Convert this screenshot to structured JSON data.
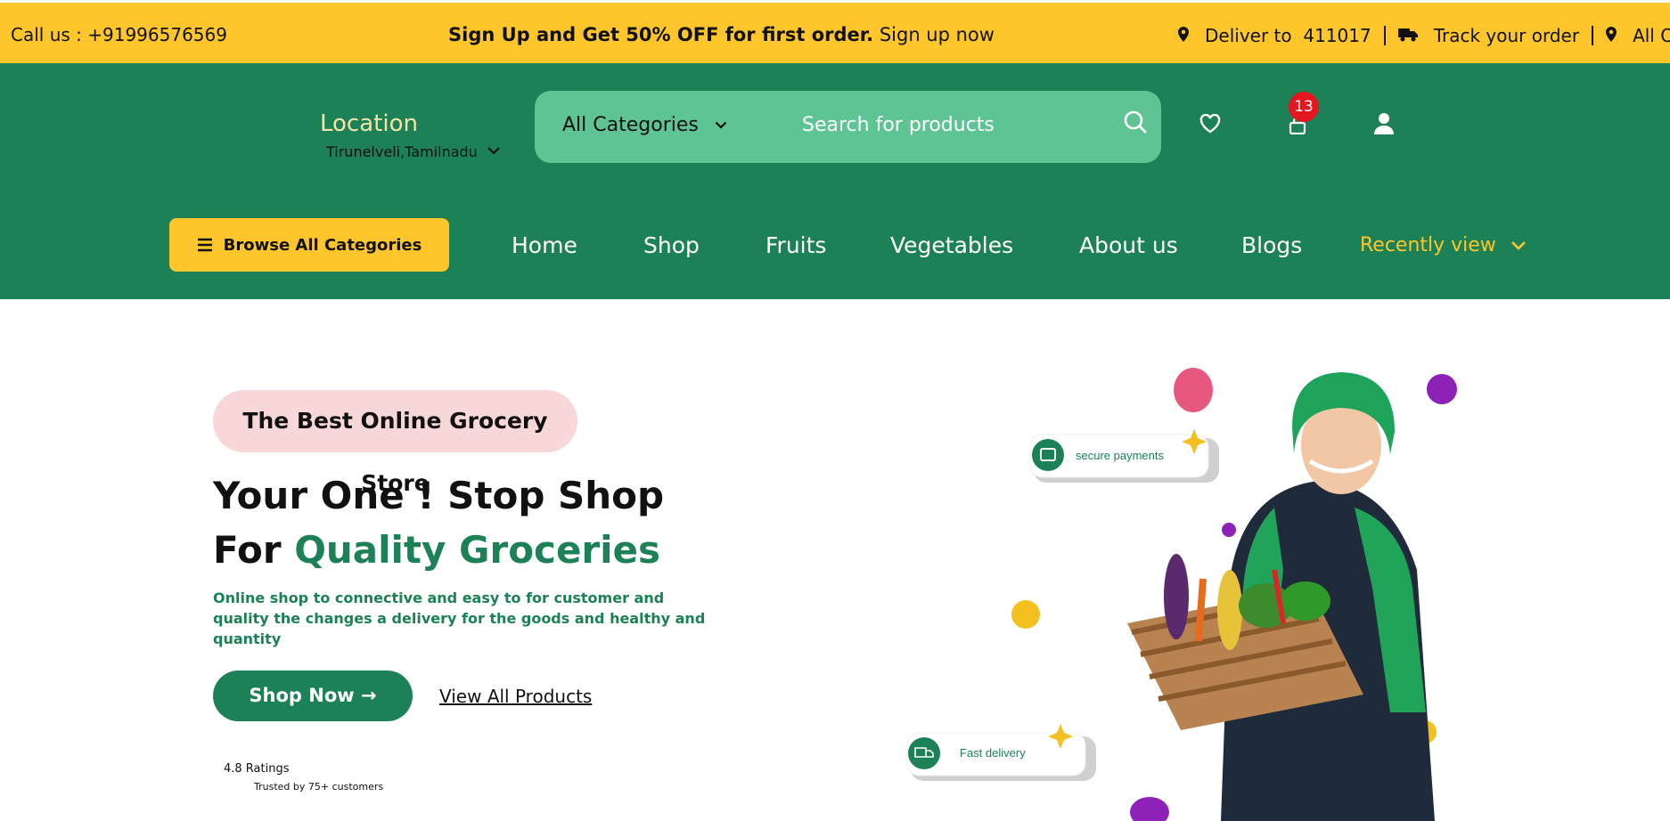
{
  "topbar": {
    "call": "Call us : +91996576569",
    "promo_bold": "Sign Up and Get 50% OFF for first order.",
    "promo_link": "Sign up now",
    "deliver_label": "Deliver to",
    "pincode": "411017",
    "track": "Track your order",
    "offers": "All Offers"
  },
  "header": {
    "location_title": "Location",
    "location_value": "Tirunelveli,Tamilnadu",
    "category_select": "All Categories",
    "search_placeholder": "Search for products",
    "cart_count": "13"
  },
  "nav": {
    "browse": "Browse All Categories",
    "items": [
      "Home",
      "Shop",
      "Fruits",
      "Vegetables",
      "About us",
      "Blogs"
    ],
    "recent": "Recently view"
  },
  "hero": {
    "pill": "The Best Online Grocery Store",
    "title_line1": "Your One ! Stop Shop",
    "title_line2_prefix": "For",
    "title_line2_green": "Quality Groceries",
    "description": "Online shop to connective and easy to for customer and quality the changes a delivery for the goods and healthy and quantity",
    "shop_now": "Shop Now →",
    "view_all": "View All Products",
    "ratings": "4.8 Ratings",
    "trusted": "Trusted by 75+ customers"
  },
  "illustration": {
    "secure_label": "secure payments",
    "delivery_label": "Fast delivery"
  },
  "colors": {
    "brand_green": "#1c8157",
    "accent_yellow": "#ffc62b",
    "search_green": "#5ec493",
    "badge_red": "#e5161d",
    "pill_pink": "#f8d7d9"
  }
}
